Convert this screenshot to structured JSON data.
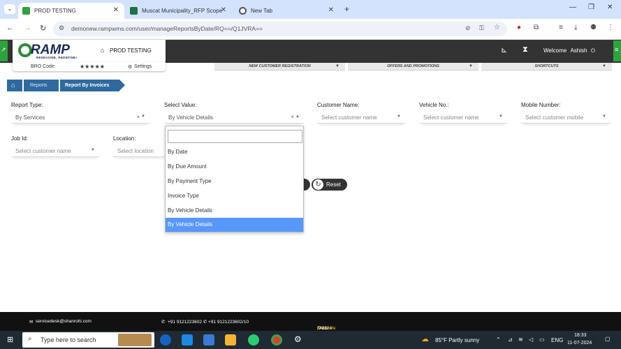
{
  "browser": {
    "tabs": [
      {
        "title": "PROD TESTING",
        "active": true
      },
      {
        "title": "Muscat Municipality_RFP Scope",
        "active": false
      },
      {
        "title": "New Tab",
        "active": false
      }
    ],
    "url": "demonew.rampwms.com/user/manageReportsByDate/RQ==/Q1JVRA=="
  },
  "app": {
    "logo": "RAMP",
    "logo_tagline": "REIMAGINE, REDEFINE!",
    "env_label": "PROD TESTING",
    "bro_code_label": "BRO Code:",
    "stars": "★★★★★",
    "settings_label": "Settings",
    "welcome": "Welcome",
    "user": "Ashish",
    "menu": [
      "NEW CUSTOMER REGISTRATION",
      "OFFERS AND PROMOTIONS",
      "SHORTCUTS"
    ]
  },
  "breadcrumb": [
    "Reports",
    "Report By Invoices"
  ],
  "form": {
    "report_type": {
      "label": "Report Type:",
      "value": "By Services"
    },
    "select_value": {
      "label": "Select Value:",
      "value": "By Vehicle Details"
    },
    "customer_name": {
      "label": "Customer Name:",
      "placeholder": "Select customer name"
    },
    "vehicle_no": {
      "label": "Vehicle No.:",
      "placeholder": "Select customer name"
    },
    "mobile_number": {
      "label": "Mobile Number:",
      "placeholder": "Select customer mobile"
    },
    "job_id": {
      "label": "Job Id:",
      "placeholder": "Select customer name"
    },
    "location": {
      "label": "Location:",
      "placeholder": "Select location"
    }
  },
  "dropdown_options": [
    "By Date",
    "By Due Amount",
    "By Payment Type",
    "Invoice Type",
    "By Vehicle Details",
    "By Vehicle Details"
  ],
  "dropdown_selected_index": 5,
  "reset_label": "Reset",
  "footer": {
    "email": "servicedesk@shanrohi.com",
    "phones": "+91 9121223602  ✆ +91 9121223602/10",
    "copyright_prefix": "© 2024 - Powered by ",
    "company": "Shanrohi Technologies Private Limited",
    "copyright_suffix": ", ALL RIGHTS RESERVED"
  },
  "taskbar": {
    "search_placeholder": "Type here to search",
    "weather": "85°F  Partly sunny",
    "lang": "ENG",
    "time": "18:33",
    "date": "11-07-2024"
  },
  "colors": {
    "accent_green": "#2ea23e",
    "breadcrumb_blue": "#2e6aa0",
    "selected_blue": "#5897fb",
    "header_dark": "#333333"
  }
}
